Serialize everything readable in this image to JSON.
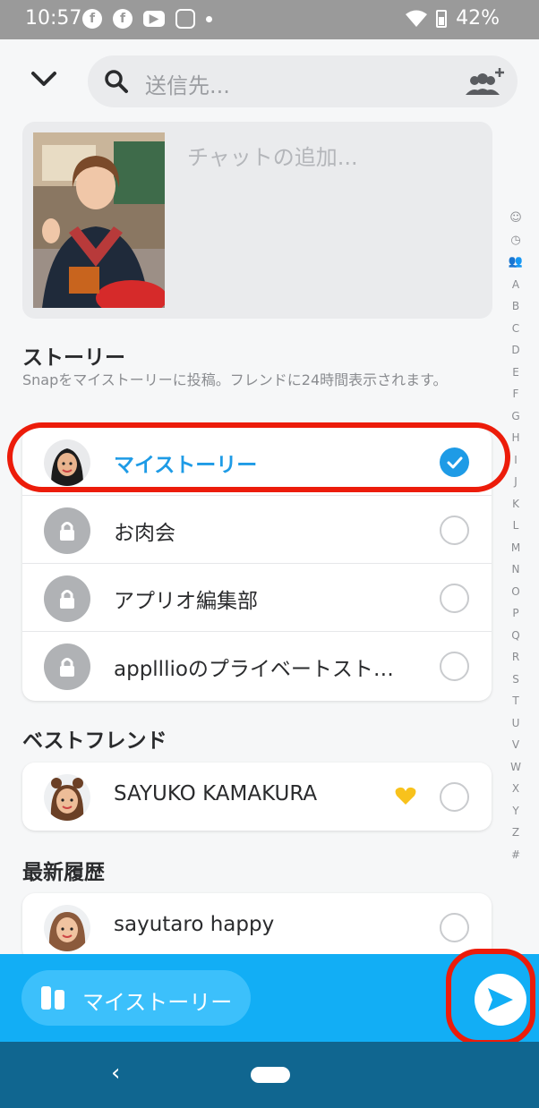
{
  "status_bar": {
    "time": "10:57",
    "battery": "42%",
    "notif_icons": [
      "facebook-icon",
      "facebook-icon",
      "youtube-icon",
      "instagram-icon"
    ]
  },
  "search": {
    "placeholder": "送信先..."
  },
  "preview": {
    "chat_placeholder": "チャットの追加..."
  },
  "stories": {
    "title": "ストーリー",
    "subtitle": "Snapをマイストーリーに投稿。フレンドに24時間表示されます。",
    "my_story": {
      "label": "マイストーリー",
      "selected": true
    },
    "items": [
      {
        "label": "お肉会",
        "selected": false
      },
      {
        "label": "アプリオ編集部",
        "selected": false
      },
      {
        "label": "applllioのプライベートスト…",
        "selected": false
      }
    ]
  },
  "best_friends": {
    "title": "ベストフレンド",
    "items": [
      {
        "label": "SAYUKO KAMAKURA",
        "badge": "yellow-heart-icon",
        "selected": false
      }
    ]
  },
  "recent": {
    "title": "最新履歴",
    "items": [
      {
        "label": "sayutaro happy",
        "selected": false
      }
    ]
  },
  "alpha_index": [
    "☺",
    "◷",
    "👥",
    "A",
    "B",
    "C",
    "D",
    "E",
    "F",
    "G",
    "H",
    "I",
    "J",
    "K",
    "L",
    "M",
    "N",
    "O",
    "P",
    "Q",
    "R",
    "S",
    "T",
    "U",
    "V",
    "W",
    "X",
    "Y",
    "Z",
    "#"
  ],
  "send_bar": {
    "chip_label": "マイストーリー"
  },
  "nav": {
    "back": "‹"
  },
  "colors": {
    "accent": "#1e9be6",
    "send_bar": "#12aef5",
    "highlight": "#ec1c0a",
    "nav": "#106690"
  }
}
